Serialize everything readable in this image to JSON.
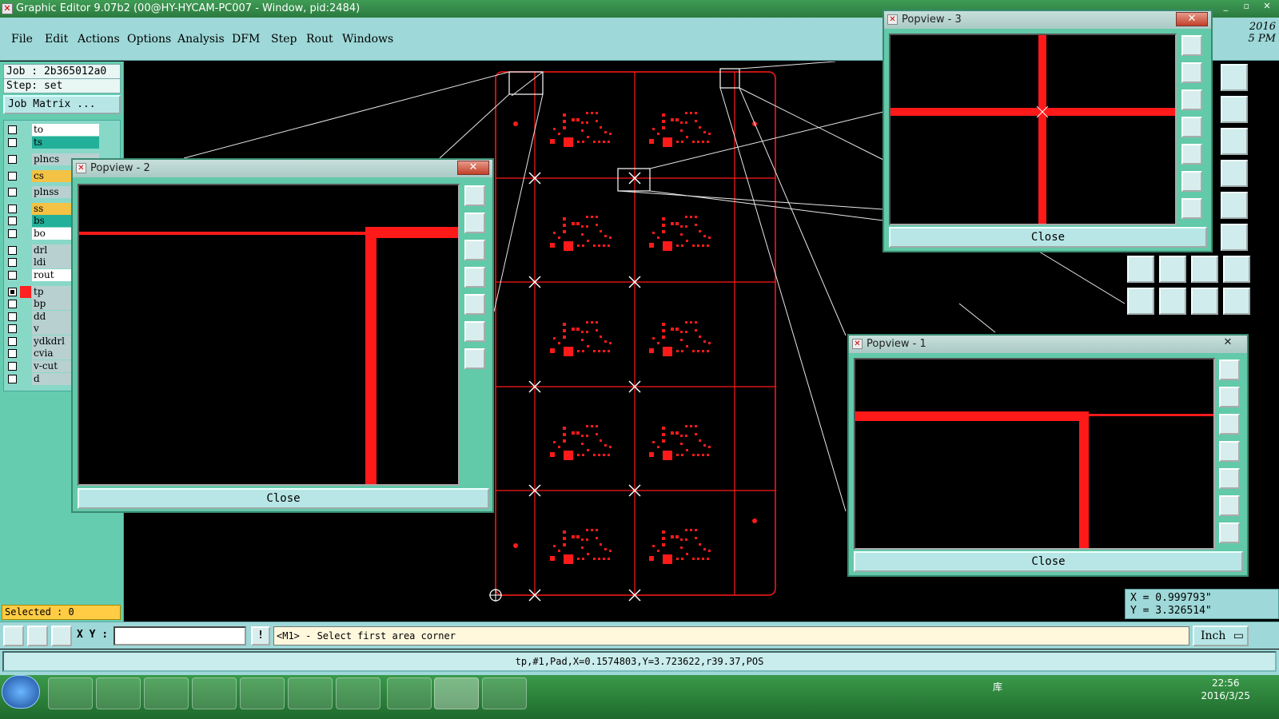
{
  "window": {
    "title": "Graphic Editor 9.07b2 (00@HY-HYCAM-PC007 - Window, pid:2484)",
    "minimize": "_",
    "restore": "▫",
    "close": "✕"
  },
  "menubar": {
    "items": [
      "File",
      "Edit",
      "Actions",
      "Options",
      "Analysis",
      "DFM",
      "Step",
      "Rout",
      "Windows"
    ],
    "year": "2016",
    "time_fragment": "5 PM"
  },
  "left_panel": {
    "job": "Job : 2b365012a0",
    "step": "Step: set",
    "job_matrix": "Job Matrix ...",
    "layers": [
      {
        "name": "to",
        "color": "#ffffff",
        "checked": false
      },
      {
        "name": "ts",
        "color": "#22b09a",
        "checked": false
      },
      {
        "name": "plncs",
        "color": "#b8d0d0",
        "checked": false
      },
      {
        "name": "cs",
        "color": "#f4c244",
        "checked": false
      },
      {
        "name": "plnss",
        "color": "#b8d0d0",
        "checked": false
      },
      {
        "name": "ss",
        "color": "#f4c244",
        "checked": false
      },
      {
        "name": "bs",
        "color": "#22b09a",
        "checked": false
      },
      {
        "name": "bo",
        "color": "#ffffff",
        "checked": false
      },
      {
        "name": "drl",
        "color": "#b8d0d0",
        "checked": false
      },
      {
        "name": "ldi",
        "color": "#b8d0d0",
        "checked": false
      },
      {
        "name": "rout",
        "color": "#ffffff",
        "checked": false
      },
      {
        "name": "tp",
        "color": "#b8d0d0",
        "checked": true,
        "active_color": "#ff2020"
      },
      {
        "name": "bp",
        "color": "#b8d0d0",
        "checked": false
      },
      {
        "name": "dd",
        "color": "#b8d0d0",
        "checked": false
      },
      {
        "name": "v",
        "color": "#b8d0d0",
        "checked": false
      },
      {
        "name": "ydkdrl",
        "color": "#b8d0d0",
        "checked": false
      },
      {
        "name": "cvia",
        "color": "#b8d0d0",
        "checked": false
      },
      {
        "name": "v-cut",
        "color": "#b8d0d0",
        "checked": false
      },
      {
        "name": "d",
        "color": "#b8d0d0",
        "checked": false
      }
    ],
    "selected": "Selected : 0"
  },
  "popviews": [
    {
      "title": "Popview - 2",
      "close_label": "Close"
    },
    {
      "title": "Popview - 3",
      "close_label": "Close"
    },
    {
      "title": "Popview - 1",
      "close_label": "Close"
    }
  ],
  "coords": {
    "x": "X = 0.999793\"",
    "y": "Y = 3.326514\""
  },
  "command_bar": {
    "xy_label": "X Y :",
    "xy_value": "",
    "info_button": "!",
    "prompt": "<M1> - Select first area corner",
    "unit": "Inch"
  },
  "status": {
    "text": "tp,#1,Pad,X=0.1574803,Y=3.723622,r39.37,POS"
  },
  "taskbar": {
    "library": "库",
    "time": "22:56",
    "date": "2016/3/25"
  },
  "colors": {
    "accent": "#9ed8d8",
    "panel": "#66ccb0",
    "feature": "#ff1a1a",
    "outline": "#ffffff"
  }
}
